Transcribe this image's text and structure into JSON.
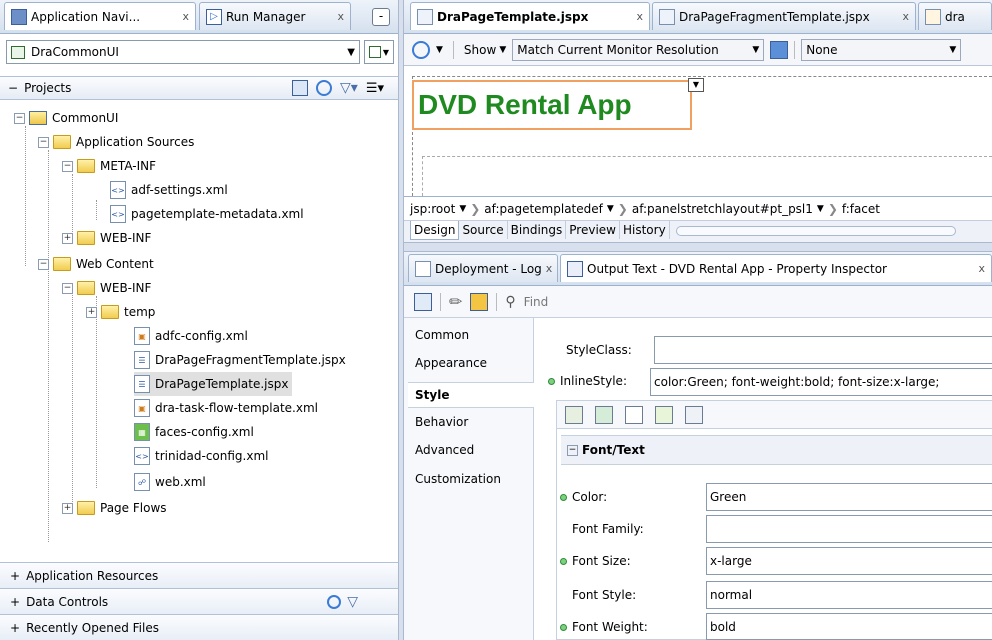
{
  "left_panel": {
    "tabs": [
      {
        "label": "Application Navi...",
        "close": "x"
      },
      {
        "label": "Run Manager",
        "close": "x"
      }
    ],
    "minimize": "-",
    "app_selector": "DraCommonUI",
    "projects_label": "Projects",
    "tree": [
      {
        "label": "CommonUI"
      },
      {
        "label": "Application Sources"
      },
      {
        "label": "META-INF"
      },
      {
        "label": "adf-settings.xml"
      },
      {
        "label": "pagetemplate-metadata.xml"
      },
      {
        "label": "WEB-INF"
      },
      {
        "label": "Web Content"
      },
      {
        "label": "WEB-INF"
      },
      {
        "label": "temp"
      },
      {
        "label": "adfc-config.xml"
      },
      {
        "label": "DraPageFragmentTemplate.jspx"
      },
      {
        "label": "DraPageTemplate.jspx"
      },
      {
        "label": "dra-task-flow-template.xml"
      },
      {
        "label": "faces-config.xml"
      },
      {
        "label": "trinidad-config.xml"
      },
      {
        "label": "web.xml"
      },
      {
        "label": "Page Flows"
      }
    ],
    "bottom": [
      {
        "label": "Application Resources"
      },
      {
        "label": "Data Controls"
      },
      {
        "label": "Recently Opened Files"
      }
    ]
  },
  "editor": {
    "tabs": [
      {
        "label": "DraPageTemplate.jspx",
        "close": "x"
      },
      {
        "label": "DraPageFragmentTemplate.jspx",
        "close": "x"
      },
      {
        "label": "dra"
      }
    ],
    "toolbar": {
      "show_label": "Show",
      "resolution": "Match Current Monitor Resolution",
      "skin": "None"
    },
    "canvas_text": "DVD Rental App",
    "breadcrumb": [
      "jsp:root",
      "af:pagetemplatedef",
      "af:panelstretchlayout#pt_psl1",
      "f:facet"
    ],
    "view_tabs": [
      "Design",
      "Source",
      "Bindings",
      "Preview",
      "History"
    ]
  },
  "inspector": {
    "tabs": [
      {
        "label": "Deployment - Log",
        "close": "x"
      },
      {
        "label": "Output Text - DVD Rental App - Property Inspector",
        "close": "x"
      }
    ],
    "find_placeholder": "Find",
    "categories": [
      "Common",
      "Appearance",
      "Style",
      "Behavior",
      "Advanced",
      "Customization"
    ],
    "style_class_label": "StyleClass:",
    "style_class_value": "",
    "inline_style_label": "InlineStyle:",
    "inline_style_value": "color:Green; font-weight:bold; font-size:x-large;",
    "section_title": "Font/Text",
    "properties": [
      {
        "label": "Color:",
        "value": "Green"
      },
      {
        "label": "Font Family:",
        "value": ""
      },
      {
        "label": "Font Size:",
        "value": "x-large"
      },
      {
        "label": "Font Style:",
        "value": "normal"
      },
      {
        "label": "Font Weight:",
        "value": "bold"
      }
    ]
  },
  "colors": {
    "canvas_text": "#1f8a1f",
    "selection": "#f0a060"
  }
}
